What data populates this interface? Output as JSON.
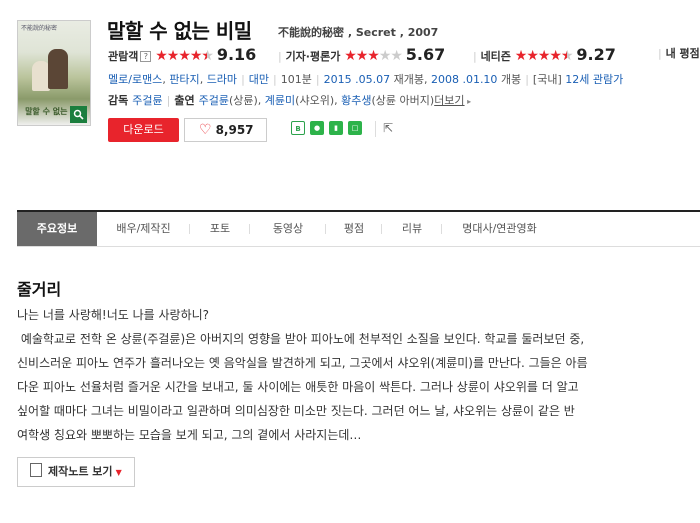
{
  "poster": {
    "mini_text": "不能說的秘密",
    "title": "말할 수 없는 비밀",
    "zoom_icon": "magnifier-icon"
  },
  "title": {
    "ko": "말할 수 없는 비밀",
    "sub": "不能說的秘密 , Secret , 2007"
  },
  "ratings": [
    {
      "label": "관람객",
      "stars": 4.5,
      "score": "9.16"
    },
    {
      "label": "기자·평론가",
      "stars": 3,
      "score": "5.67"
    },
    {
      "label": "네티즌",
      "stars": 4.5,
      "score": "9.27"
    },
    {
      "label": "내 평점"
    }
  ],
  "info": {
    "genres": [
      "멜로/로맨스",
      "판타지",
      "드라마"
    ],
    "country": "대만",
    "runtime": "101분",
    "release1_date": "2015 .05.07",
    "release1_label": "재개봉",
    "release2_date": "2008 .01.10",
    "release2_label": "개봉",
    "region": "[국내]",
    "rating": "12세 관람가"
  },
  "cast": {
    "director_label": "감독",
    "director": "주걸륜",
    "actors_label": "출연",
    "actors": [
      {
        "name": "주걸륜",
        "role": "(상륜)"
      },
      {
        "name": "계륜미",
        "role": "(샤오위)"
      },
      {
        "name": "황추생",
        "role": "(상륜 아버지)"
      }
    ],
    "more": "더보기"
  },
  "buttons": {
    "download": "다운로드",
    "likes": "8,957"
  },
  "share_icons": [
    "band-icon",
    "line-icon",
    "bookmark-icon",
    "memo-icon",
    "share-icon"
  ],
  "tabs": [
    "주요정보",
    "배우/제작진",
    "포토",
    "동영상",
    "평점",
    "리뷰",
    "명대사/연관영화"
  ],
  "synopsis": {
    "heading": "줄거리",
    "lines": [
      "나는 너를 사랑해!너도 나를 사랑하니?",
      " 예술학교로 전학 온 상륜(주걸륜)은 아버지의 영향을 받아 피아노에 천부적인 소질을 보인다. 학교를 둘러보던 중,",
      "신비스러운 피아노 연주가 흘러나오는 옛 음악실을 발견하게 되고, 그곳에서 샤오위(계륜미)를 만난다. 그들은 아름",
      "다운 피아노 선율처럼 즐거운 시간을 보내고, 둘 사이에는 애틋한 마음이 싹튼다. 그러나 상륜이 샤오위를 더 알고",
      "싶어할 때마다 그녀는 비밀이라고 일관하며 의미심장한 미소만 짓는다. 그러던 어느 날, 샤오위는 상륜이 같은 반",
      "여학생 칭요와 뽀뽀하는 모습을 보게 되고, 그의 곁에서 사라지는데…"
    ],
    "more_button": "제작노트 보기"
  },
  "colors": {
    "accent": "#e8242c",
    "link": "#1a5fb4",
    "tab_active": "#6a6a6a"
  }
}
